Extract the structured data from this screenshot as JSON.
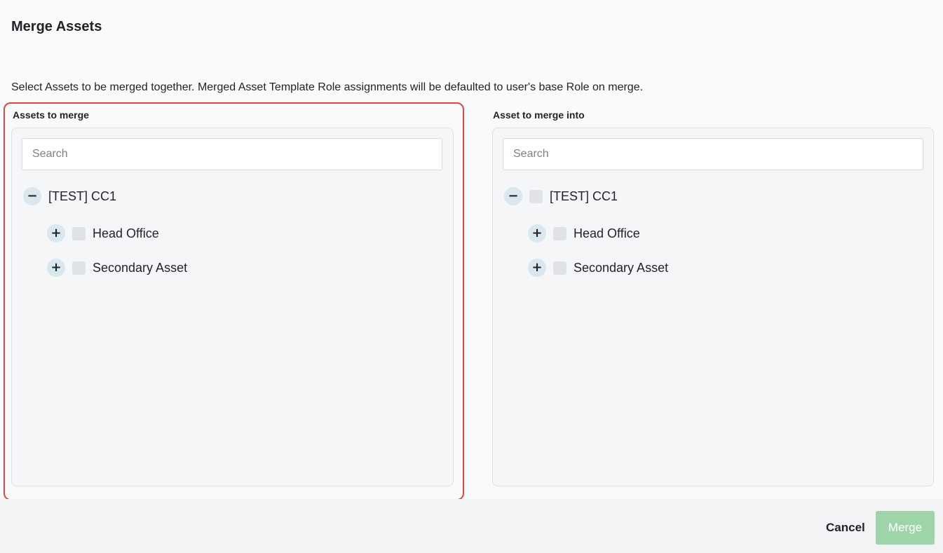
{
  "dialog": {
    "title": "Merge Assets",
    "description": "Select Assets to be merged together. Merged Asset Template Role assignments will be defaulted to user's base Role on merge."
  },
  "left_panel": {
    "label": "Assets to merge",
    "search_placeholder": "Search",
    "search_value": "",
    "tree": {
      "root": {
        "label": "[TEST] CC1",
        "toggle": "−",
        "expanded": true,
        "has_checkbox": false
      },
      "children": [
        {
          "label": "Head Office",
          "toggle": "+",
          "expanded": false,
          "checked": false
        },
        {
          "label": "Secondary Asset",
          "toggle": "+",
          "expanded": false,
          "checked": false
        }
      ]
    },
    "highlight_color": "#e5463b"
  },
  "right_panel": {
    "label": "Asset to merge into",
    "search_placeholder": "Search",
    "search_value": "",
    "tree": {
      "root": {
        "label": "[TEST] CC1",
        "toggle": "−",
        "expanded": true,
        "has_checkbox": true,
        "checked": false
      },
      "children": [
        {
          "label": "Head Office",
          "toggle": "+",
          "expanded": false,
          "checked": false
        },
        {
          "label": "Secondary Asset",
          "toggle": "+",
          "expanded": false,
          "checked": false
        }
      ]
    }
  },
  "footer": {
    "cancel_label": "Cancel",
    "merge_label": "Merge",
    "merge_disabled": true,
    "merge_color": "#9ed5a8"
  }
}
